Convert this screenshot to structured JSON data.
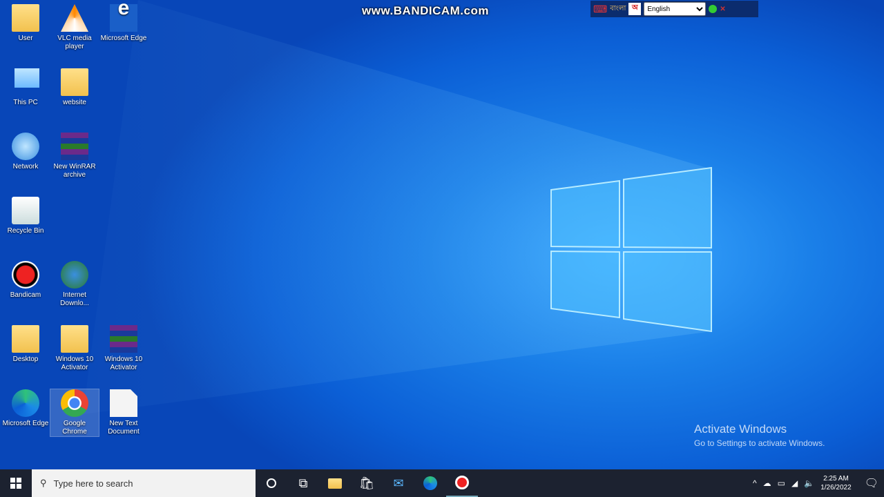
{
  "watermark": "www.BANDICAM.com",
  "langbar": {
    "ime_label": "বাংলা",
    "language": "English"
  },
  "desktop_icons": [
    {
      "label": "User"
    },
    {
      "label": "VLC media player"
    },
    {
      "label": "Microsoft Edge"
    },
    {
      "label": "This PC"
    },
    {
      "label": "website"
    },
    {
      "label": "Network"
    },
    {
      "label": "New WinRAR archive"
    },
    {
      "label": "Recycle Bin"
    },
    {
      "label": "Bandicam"
    },
    {
      "label": "Internet Downlo..."
    },
    {
      "label": "Desktop"
    },
    {
      "label": "Windows 10 Activator"
    },
    {
      "label": "Windows 10 Activator"
    },
    {
      "label": "Microsoft Edge"
    },
    {
      "label": "Google Chrome"
    },
    {
      "label": "New Text Document"
    }
  ],
  "activation": {
    "title": "Activate Windows",
    "subtitle": "Go to Settings to activate Windows."
  },
  "taskbar": {
    "search_placeholder": "Type here to search",
    "time": "2:25 AM",
    "date": "1/26/2022"
  },
  "colors": {
    "accent": "#1a7fe8",
    "taskbar": "#1c2230"
  }
}
